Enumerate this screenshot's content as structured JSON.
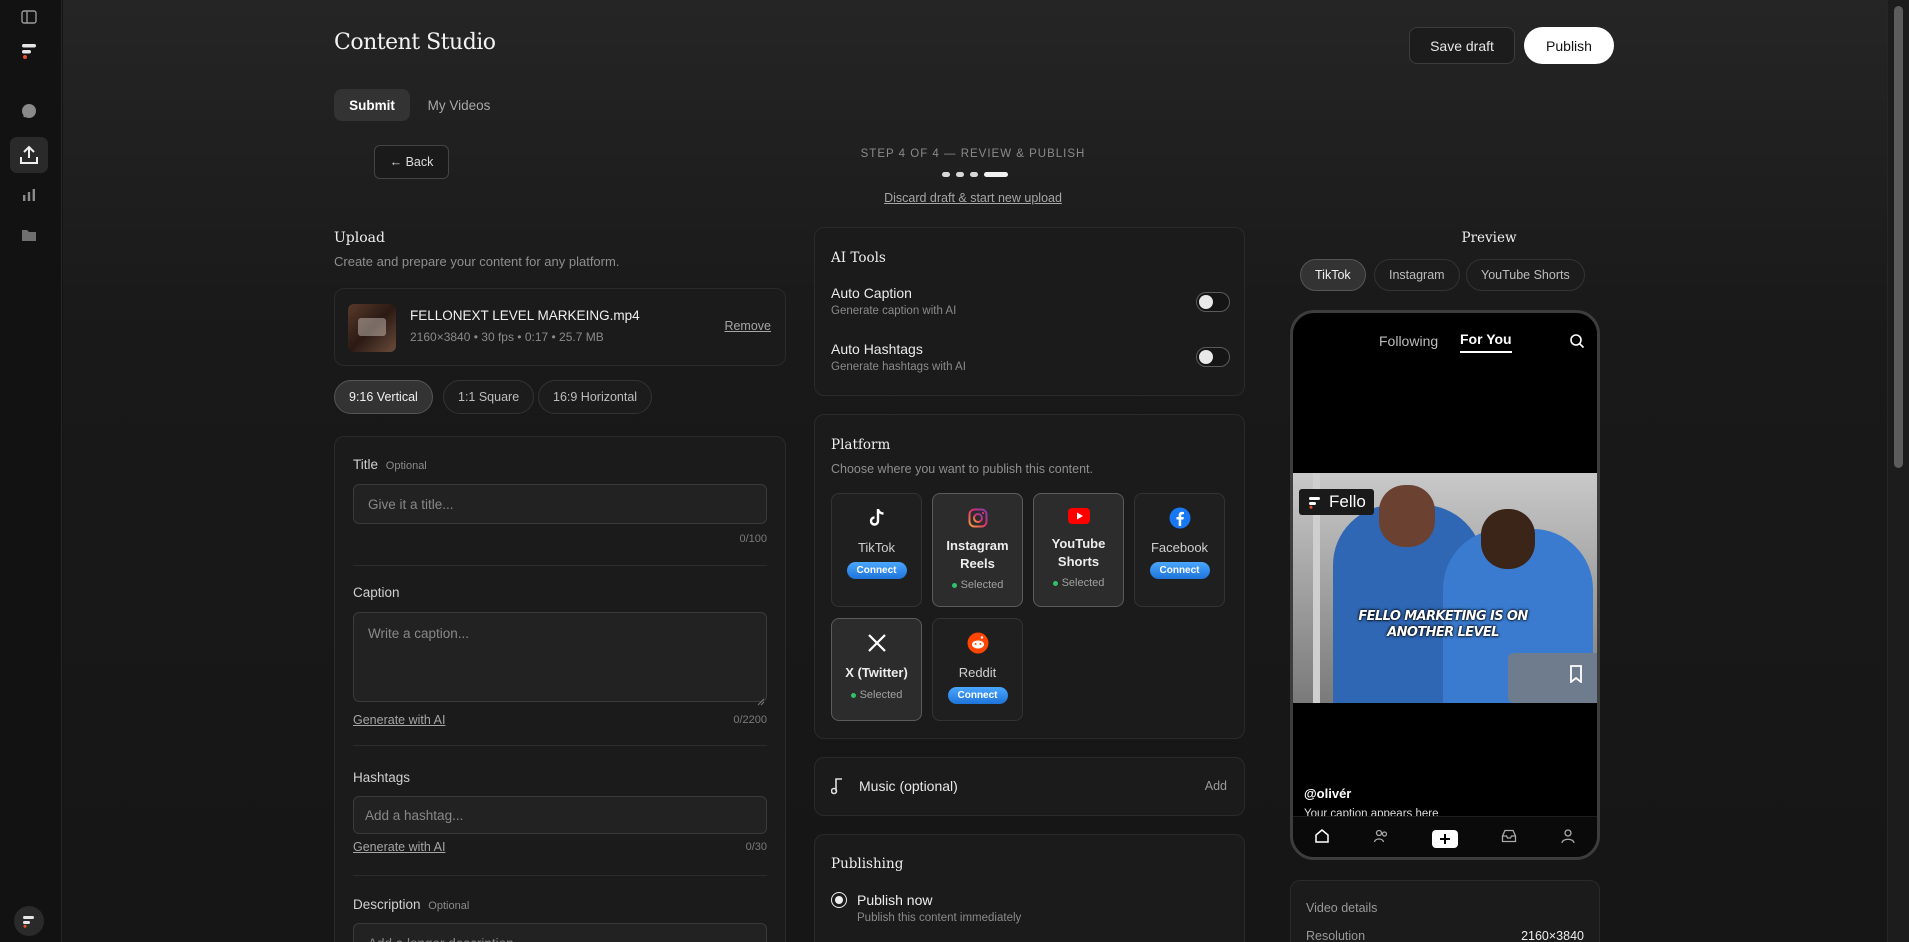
{
  "app": {
    "title": "Content Studio"
  },
  "header": {
    "save_draft": "Save draft",
    "publish": "Publish"
  },
  "tabs": [
    {
      "label": "Submit"
    },
    {
      "label": "My Videos"
    }
  ],
  "back": "← Back",
  "step": {
    "text": "STEP 4 OF 4 — REVIEW & PUBLISH",
    "discard": "Discard draft & start new upload"
  },
  "upload": {
    "heading": "Upload",
    "subtitle": "Create and prepare your content for any platform.",
    "file_name": "FELLONEXT LEVEL MARKEING.mp4",
    "file_meta": "2160×3840 • 30 fps • 0:17 • 25.7 MB",
    "remove": "Remove"
  },
  "aspect": [
    {
      "label": "9:16 Vertical"
    },
    {
      "label": "1:1 Square"
    },
    {
      "label": "16:9 Horizontal"
    }
  ],
  "form": {
    "title_label": "Title",
    "title_optional": "Optional",
    "title_placeholder": "Give it a title...",
    "title_count": "0/100",
    "caption_label": "Caption",
    "caption_placeholder": "Write a caption...",
    "caption_generate": "Generate with AI",
    "caption_count": "0/2200",
    "hashtags_label": "Hashtags",
    "hashtags_placeholder": "Add a hashtag...",
    "hashtags_generate": "Generate with AI",
    "hashtags_count": "0/30",
    "description_label": "Description",
    "description_optional": "Optional",
    "description_placeholder": "Add a longer description..."
  },
  "ai_tools": {
    "heading": "AI Tools",
    "auto_caption": "Auto Caption",
    "auto_caption_sub": "Generate caption with AI",
    "auto_hashtags": "Auto Hashtags",
    "auto_hashtags_sub": "Generate hashtags with AI"
  },
  "platform": {
    "heading": "Platform",
    "subtitle": "Choose where you want to publish this content.",
    "connect": "Connect",
    "selected": "Selected",
    "tiktok": "TikTok",
    "instagram_l1": "Instagram",
    "instagram_l2": "Reels",
    "youtube_l1": "YouTube",
    "youtube_l2": "Shorts",
    "facebook": "Facebook",
    "x": "X (Twitter)",
    "reddit": "Reddit"
  },
  "music": {
    "label": "Music (optional)",
    "add": "Add"
  },
  "publishing": {
    "heading": "Publishing",
    "option": "Publish now",
    "option_sub": "Publish this content immediately"
  },
  "preview": {
    "heading": "Preview",
    "tabs": [
      {
        "label": "TikTok"
      },
      {
        "label": "Instagram"
      },
      {
        "label": "YouTube Shorts"
      }
    ],
    "following": "Following",
    "for_you": "For You",
    "brand": "Fello",
    "overlay_l1": "FELLO MARKETING IS ON",
    "overlay_l2": "ANOTHER LEVEL",
    "handle": "@olivér",
    "caption": "Your caption appears here"
  },
  "video_details": {
    "heading": "Video details",
    "res_label": "Resolution",
    "res_value": "2160×3840"
  },
  "colors": {
    "bg": "#141414",
    "connect": "#2f86ea",
    "selected_dot": "#2fc16b",
    "youtube": "#ff0000",
    "facebook": "#1877f2",
    "reddit": "#ff4500"
  }
}
